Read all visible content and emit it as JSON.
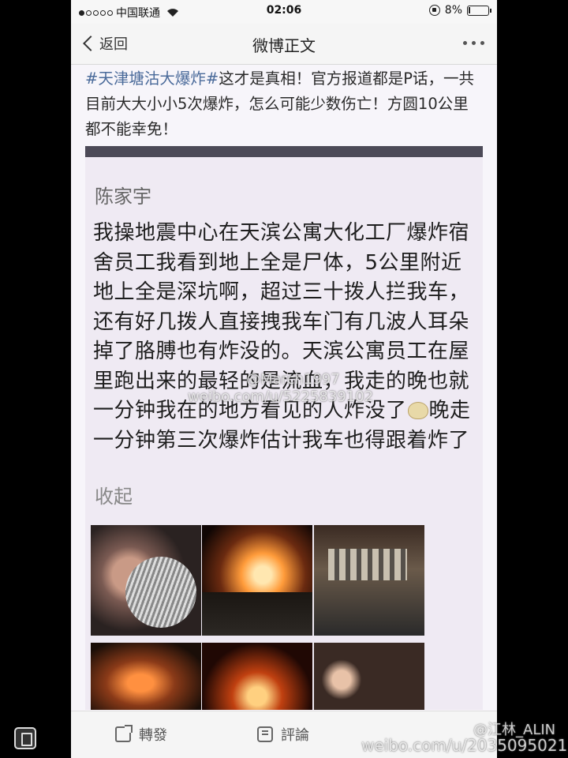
{
  "status_bar": {
    "carrier": "中国联通",
    "time": "02:06",
    "battery": "8%",
    "battery_level": 0.08
  },
  "nav": {
    "back_label": "返回",
    "title": "微博正文"
  },
  "post": {
    "hashtag": "#天津塘沽大爆炸#",
    "text": "这才是真相！官方报道都是P话，一共目前大大小小5次爆炸，怎么可能少数伤亡！方圆10公里都不能幸免！"
  },
  "repost": {
    "author": "陈家宇",
    "text_part1": "我操地震中心在天滨公寓大化工厂爆炸宿舍员工我看到地上全是尸体，5公里附近地上全是深坑啊，超过三十拨人拦我车，还有好几拨人直接拽我车门有几波人耳朵掉了胳膊也有炸没的。天滨公寓员工在屋里跑出来的最轻的是流血，我走的晚也就一分钟我在的地方看见的人炸没了",
    "text_part2": "晚走一分钟第三次爆炸估计我车也得跟着炸了",
    "collapse_label": "收起"
  },
  "watermarks": {
    "mid_user": "@March1997",
    "mid_url": "weibo.com/u/5225839102",
    "bottom_user": "@江林_ALIN",
    "bottom_url": "weibo.com/u/2035095021"
  },
  "toolbar": {
    "forward_label": "轉發",
    "comment_label": "評論"
  }
}
